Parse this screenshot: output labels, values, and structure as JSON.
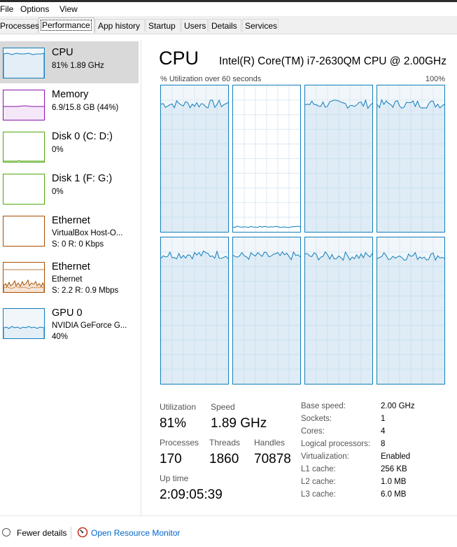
{
  "menu": [
    "File",
    "Options",
    "View"
  ],
  "tabs": [
    {
      "label": "Processes",
      "active": false
    },
    {
      "label": "Performance",
      "active": true
    },
    {
      "label": "App history",
      "active": false
    },
    {
      "label": "Startup",
      "active": false
    },
    {
      "label": "Users",
      "active": false
    },
    {
      "label": "Details",
      "active": false
    },
    {
      "label": "Services",
      "active": false
    }
  ],
  "sidebar": {
    "items": [
      {
        "title": "CPU",
        "sub1": "81% 1.89 GHz",
        "sub2": "",
        "color": "#117dbb"
      },
      {
        "title": "Memory",
        "sub1": "6.9/15.8 GB (44%)",
        "sub2": "",
        "color": "#8b12ae"
      },
      {
        "title": "Disk 0 (C: D:)",
        "sub1": "0%",
        "sub2": "",
        "color": "#4da60c"
      },
      {
        "title": "Disk 1 (F: G:)",
        "sub1": "0%",
        "sub2": "",
        "color": "#4da60c"
      },
      {
        "title": "Ethernet",
        "sub1": "VirtualBox Host-O...",
        "sub2": "S: 0 R: 0 Kbps",
        "color": "#a74f01"
      },
      {
        "title": "Ethernet",
        "sub1": "Ethernet",
        "sub2": "S: 2.2 R: 0.9 Mbps",
        "color": "#a74f01"
      },
      {
        "title": "GPU 0",
        "sub1": "NVIDIA GeForce G...",
        "sub2": "40%",
        "color": "#117dbb"
      }
    ]
  },
  "main": {
    "title": "CPU",
    "model": "Intel(R) Core(TM) i7-2630QM CPU @ 2.00GHz",
    "util_label": "% Utilization over 60 seconds",
    "util_max": "100%",
    "core_util_percent": [
      88,
      2,
      88,
      88,
      89,
      88,
      88,
      88
    ]
  },
  "stats": {
    "utilization_label": "Utilization",
    "utilization": "81%",
    "speed_label": "Speed",
    "speed": "1.89 GHz",
    "processes_label": "Processes",
    "processes": "170",
    "threads_label": "Threads",
    "threads": "1860",
    "handles_label": "Handles",
    "handles": "70878",
    "uptime_label": "Up time",
    "uptime": "2:09:05:39"
  },
  "details": [
    {
      "label": "Base speed:",
      "value": "2.00 GHz"
    },
    {
      "label": "Sockets:",
      "value": "1"
    },
    {
      "label": "Cores:",
      "value": "4"
    },
    {
      "label": "Logical processors:",
      "value": "8"
    },
    {
      "label": "Virtualization:",
      "value": "Enabled"
    },
    {
      "label": "L1 cache:",
      "value": "256 KB"
    },
    {
      "label": "L2 cache:",
      "value": "1.0 MB"
    },
    {
      "label": "L3 cache:",
      "value": "6.0 MB"
    }
  ],
  "footer": {
    "fewer_details": "Fewer details",
    "open_resource_monitor": "Open Resource Monitor"
  }
}
